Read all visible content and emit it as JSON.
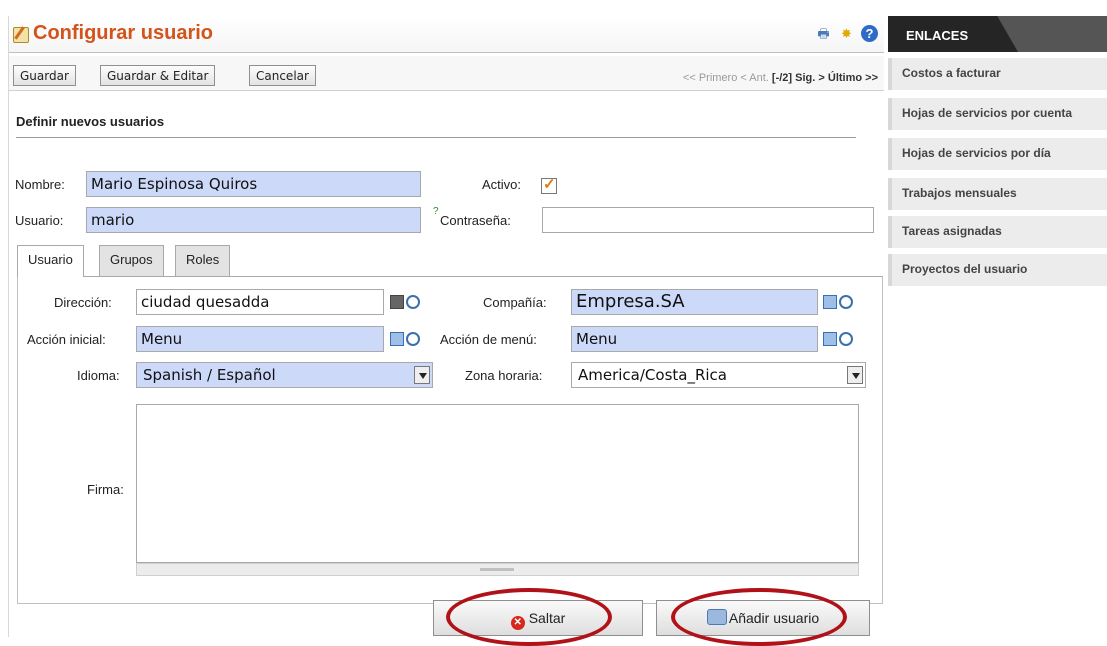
{
  "header": {
    "title": "Configurar usuario",
    "icons": [
      "print-icon",
      "bug-icon",
      "help-icon"
    ]
  },
  "toolbar": {
    "save_label": "Guardar",
    "save_edit_label": "Guardar & Editar",
    "cancel_label": "Cancelar",
    "pager_first": "<< Primero",
    "pager_prev": "< Ant.",
    "pager_current": "[-/2]",
    "pager_next": "Sig. >",
    "pager_last": "Último >>"
  },
  "section": {
    "title": "Definir nuevos usuarios"
  },
  "form": {
    "name_label": "Nombre:",
    "name_value": "Mario Espinosa Quiros",
    "active_label": "Activo:",
    "active_checked": true,
    "user_label": "Usuario:",
    "user_value": "mario",
    "password_hint": "?",
    "password_label": "Contraseña:",
    "password_value": ""
  },
  "tabs": [
    {
      "label": "Usuario",
      "active": true
    },
    {
      "label": "Grupos",
      "active": false
    },
    {
      "label": "Roles",
      "active": false
    }
  ],
  "details": {
    "address_label": "Dirección:",
    "address_value": "ciudad quesadda",
    "company_label": "Compañía:",
    "company_value": "Empresa.SA",
    "initial_action_label": "Acción inicial:",
    "initial_action_value": "Menu",
    "menu_action_label": "Acción de menú:",
    "menu_action_value": "Menu",
    "language_label": "Idioma:",
    "language_value": "Spanish / Español",
    "timezone_label": "Zona horaria:",
    "timezone_value": "America/Costa_Rica",
    "signature_label": "Firma:",
    "signature_value": ""
  },
  "actions": {
    "skip_label": "Saltar",
    "add_user_label": "Añadir usuario"
  },
  "links": {
    "title": "ENLACES",
    "items": [
      "Costos a facturar",
      "Hojas de servicios por cuenta",
      "Hojas de servicios por día",
      "Trabajos mensuales",
      "Tareas asignadas",
      "Proyectos del usuario"
    ]
  },
  "colors": {
    "title": "#d4531a",
    "input_fill": "#ccd9f9",
    "highlight_ring": "#b01218",
    "links_header": "#252525"
  }
}
